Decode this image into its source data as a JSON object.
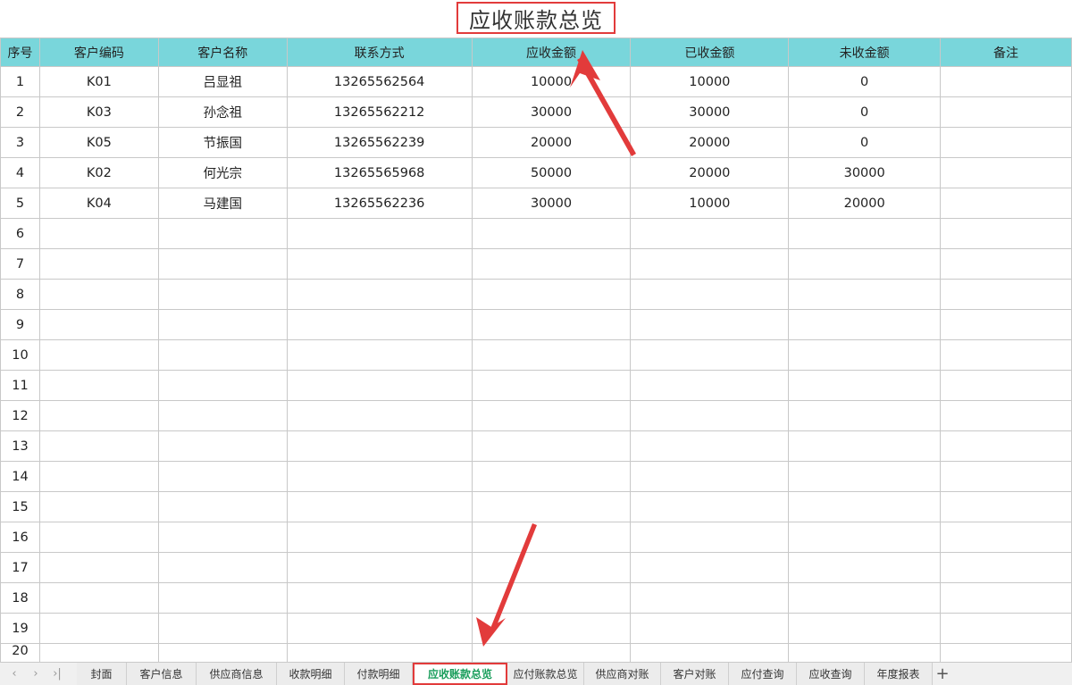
{
  "title": "应收账款总览",
  "columns": [
    "序号",
    "客户编码",
    "客户名称",
    "联系方式",
    "应收金额",
    "已收金额",
    "未收金额",
    "备注"
  ],
  "rows": [
    [
      "1",
      "K01",
      "吕显祖",
      "13265562564",
      "10000",
      "10000",
      "0",
      ""
    ],
    [
      "2",
      "K03",
      "孙念祖",
      "13265562212",
      "30000",
      "30000",
      "0",
      ""
    ],
    [
      "3",
      "K05",
      "节振国",
      "13265562239",
      "20000",
      "20000",
      "0",
      ""
    ],
    [
      "4",
      "K02",
      "何光宗",
      "13265565968",
      "50000",
      "20000",
      "30000",
      ""
    ],
    [
      "5",
      "K04",
      "马建国",
      "13265562236",
      "30000",
      "10000",
      "20000",
      ""
    ],
    [
      "6",
      "",
      "",
      "",
      "",
      "",
      "",
      ""
    ],
    [
      "7",
      "",
      "",
      "",
      "",
      "",
      "",
      ""
    ],
    [
      "8",
      "",
      "",
      "",
      "",
      "",
      "",
      ""
    ],
    [
      "9",
      "",
      "",
      "",
      "",
      "",
      "",
      ""
    ],
    [
      "10",
      "",
      "",
      "",
      "",
      "",
      "",
      ""
    ],
    [
      "11",
      "",
      "",
      "",
      "",
      "",
      "",
      ""
    ],
    [
      "12",
      "",
      "",
      "",
      "",
      "",
      "",
      ""
    ],
    [
      "13",
      "",
      "",
      "",
      "",
      "",
      "",
      ""
    ],
    [
      "14",
      "",
      "",
      "",
      "",
      "",
      "",
      ""
    ],
    [
      "15",
      "",
      "",
      "",
      "",
      "",
      "",
      ""
    ],
    [
      "16",
      "",
      "",
      "",
      "",
      "",
      "",
      ""
    ],
    [
      "17",
      "",
      "",
      "",
      "",
      "",
      "",
      ""
    ],
    [
      "18",
      "",
      "",
      "",
      "",
      "",
      "",
      ""
    ],
    [
      "19",
      "",
      "",
      "",
      "",
      "",
      "",
      ""
    ],
    [
      "20",
      "",
      "",
      "",
      "",
      "",
      "",
      ""
    ]
  ],
  "tabs": [
    "封面",
    "客户信息",
    "供应商信息",
    "收款明细",
    "付款明细",
    "应收账款总览",
    "应付账款总览",
    "供应商对账",
    "客户对账",
    "应付查询",
    "应收查询",
    "年度报表"
  ],
  "active_tab": "应收账款总览",
  "nav": {
    "first": "‹",
    "prev": "›",
    "last": "›|"
  },
  "add_sheet_label": "+",
  "colors": {
    "header_bg": "#79d6db",
    "highlight": "#e23b3b",
    "active_tab_text": "#1a9e5c"
  }
}
